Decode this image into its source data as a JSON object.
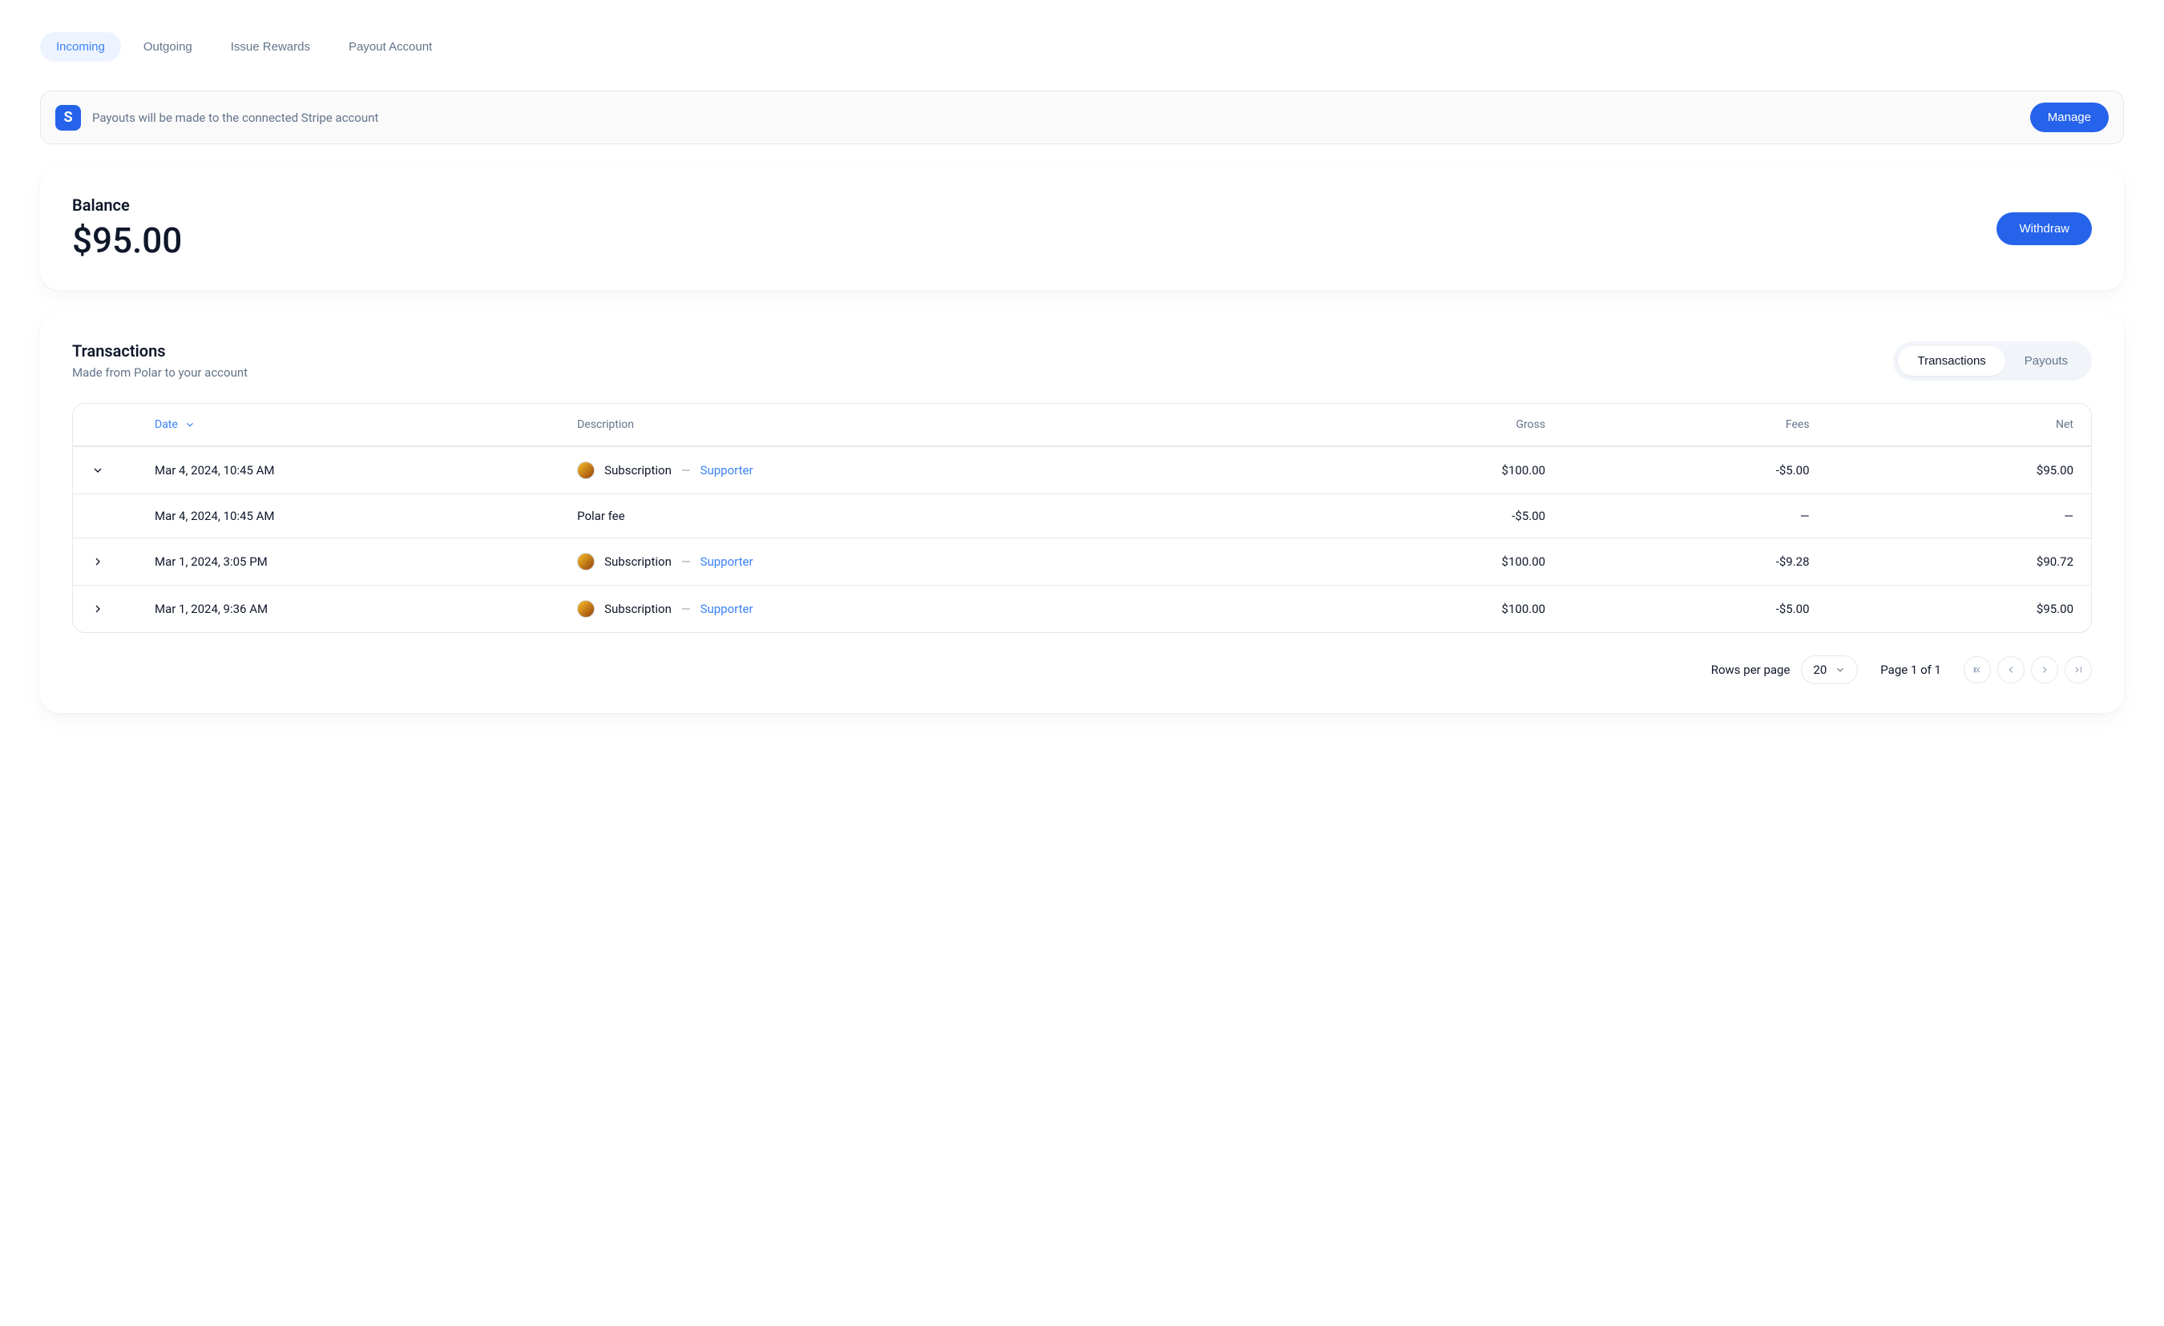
{
  "nav": {
    "tabs": [
      {
        "label": "Incoming",
        "active": true
      },
      {
        "label": "Outgoing",
        "active": false
      },
      {
        "label": "Issue Rewards",
        "active": false
      },
      {
        "label": "Payout Account",
        "active": false
      }
    ]
  },
  "banner": {
    "icon_letter": "S",
    "text": "Payouts will be made to the connected Stripe account",
    "manage_label": "Manage"
  },
  "balance": {
    "label": "Balance",
    "amount": "$95.00",
    "withdraw_label": "Withdraw"
  },
  "transactions": {
    "title": "Transactions",
    "subtitle": "Made from Polar to your account",
    "segments": [
      {
        "label": "Transactions",
        "active": true
      },
      {
        "label": "Payouts",
        "active": false
      }
    ],
    "columns": {
      "date": "Date",
      "description": "Description",
      "gross": "Gross",
      "fees": "Fees",
      "net": "Net"
    },
    "rows": [
      {
        "expandable": true,
        "expanded": true,
        "date": "Mar 4, 2024, 10:45 AM",
        "desc_type": "Subscription",
        "sep": "—",
        "desc_link": "Supporter",
        "has_avatar": true,
        "gross": "$100.00",
        "fees": "-$5.00",
        "net": "$95.00"
      },
      {
        "expandable": false,
        "expanded": false,
        "date": "Mar 4, 2024, 10:45 AM",
        "desc_type": "Polar fee",
        "sep": "",
        "desc_link": "",
        "has_avatar": false,
        "gross": "-$5.00",
        "fees": "—",
        "net": "—"
      },
      {
        "expandable": true,
        "expanded": false,
        "date": "Mar 1, 2024, 3:05 PM",
        "desc_type": "Subscription",
        "sep": "—",
        "desc_link": "Supporter",
        "has_avatar": true,
        "gross": "$100.00",
        "fees": "-$9.28",
        "net": "$90.72"
      },
      {
        "expandable": true,
        "expanded": false,
        "date": "Mar 1, 2024, 9:36 AM",
        "desc_type": "Subscription",
        "sep": "—",
        "desc_link": "Supporter",
        "has_avatar": true,
        "gross": "$100.00",
        "fees": "-$5.00",
        "net": "$95.00"
      }
    ]
  },
  "pagination": {
    "rows_per_page_label": "Rows per page",
    "rows_per_page_value": "20",
    "page_status": "Page 1 of 1"
  }
}
